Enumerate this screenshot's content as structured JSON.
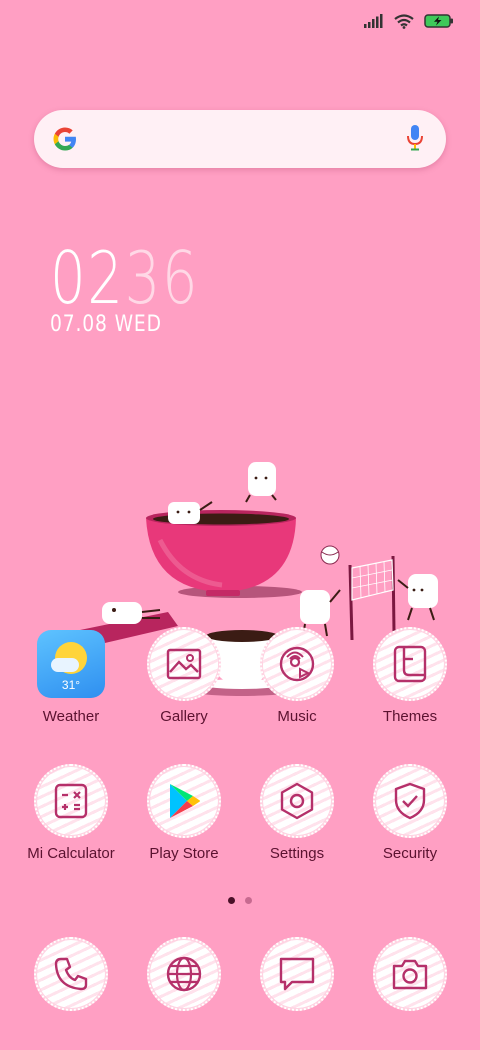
{
  "status": {
    "signal": "signal-icon",
    "wifi": "wifi-icon",
    "battery": "battery-charging-icon"
  },
  "search": {
    "logo": "google-g-icon",
    "mic": "microphone-icon"
  },
  "clock": {
    "hours": "02",
    "minutes": "36",
    "date": "07.08 WED"
  },
  "weather": {
    "temp": "31°"
  },
  "apps_row1": [
    {
      "label": "Weather",
      "icon": "weather-icon"
    },
    {
      "label": "Gallery",
      "icon": "gallery-icon"
    },
    {
      "label": "Music",
      "icon": "music-icon"
    },
    {
      "label": "Themes",
      "icon": "themes-icon"
    }
  ],
  "apps_row2": [
    {
      "label": "Mi Calculator",
      "icon": "calculator-icon"
    },
    {
      "label": "Play Store",
      "icon": "play-store-icon"
    },
    {
      "label": "Settings",
      "icon": "settings-icon"
    },
    {
      "label": "Security",
      "icon": "security-icon"
    }
  ],
  "dock": [
    {
      "icon": "phone-icon"
    },
    {
      "icon": "browser-icon"
    },
    {
      "icon": "messages-icon"
    },
    {
      "icon": "camera-icon"
    }
  ],
  "pager": {
    "pages": 2,
    "active": 1
  },
  "colors": {
    "background": "#ff9fc3",
    "icon_stroke": "#b5306a",
    "label": "#5b1230"
  }
}
